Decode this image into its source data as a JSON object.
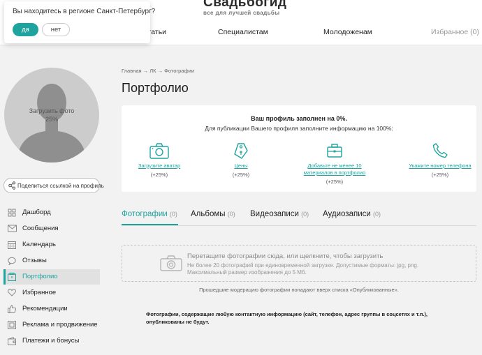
{
  "header": {
    "logo_title": "Свадьбогид",
    "logo_subtitle": "все для лучшей свадьбы",
    "nav": [
      "Статьи",
      "Специалистам",
      "Молодоженам",
      "Избранное (0)"
    ]
  },
  "region_popup": {
    "question": "Вы находитесь в регионе Санкт-Петербург?",
    "yes": "да",
    "no": "нет"
  },
  "profile": {
    "upload_photo": "Загрузить фото",
    "upload_percent": "25%",
    "share_label": "Поделиться ссылкой на профиль"
  },
  "sidebar": {
    "items": [
      {
        "label": "Дашборд",
        "icon": "dashboard-icon"
      },
      {
        "label": "Сообщения",
        "icon": "envelope-icon"
      },
      {
        "label": "Календарь",
        "icon": "calendar-icon"
      },
      {
        "label": "Отзывы",
        "icon": "chat-bubble-icon"
      },
      {
        "label": "Портфолио",
        "icon": "portfolio-icon",
        "active": true
      },
      {
        "label": "Избранное",
        "icon": "heart-icon"
      },
      {
        "label": "Рекомендации",
        "icon": "thumbs-up-icon"
      },
      {
        "label": "Реклама и продвижение",
        "icon": "ad-icon"
      },
      {
        "label": "Платежи и бонусы",
        "icon": "wallet-icon"
      }
    ]
  },
  "main": {
    "breadcrumb": "Главная → ЛК → Фотографии",
    "title": "Портфолио",
    "completion": {
      "headline": "Ваш профиль заполнен на 0%.",
      "subline": "Для публикации Вашего профиля заполните информацию на 100%:",
      "items": [
        {
          "label": "Загрузите аватар",
          "percent": "(+25%)",
          "icon": "camera-icon"
        },
        {
          "label": "Цены",
          "percent": "(+25%)",
          "icon": "price-tag-icon"
        },
        {
          "label": "Добавьте не менее 10 материалов в портфолио",
          "percent": "(+25%)",
          "icon": "briefcase-icon"
        },
        {
          "label": "Укажите номер телефона",
          "percent": "(+25%)",
          "icon": "phone-icon"
        }
      ]
    },
    "tabs": [
      {
        "label": "Фотографии",
        "count": "(0)",
        "active": true
      },
      {
        "label": "Альбомы",
        "count": "(0)"
      },
      {
        "label": "Видеозаписи",
        "count": "(0)"
      },
      {
        "label": "Аудиозаписи",
        "count": "(0)"
      }
    ],
    "dropzone": {
      "main": "Перетащите фотографии сюда, или щелкните, чтобы загрузить",
      "line1": "Не более 20 фотографий при единовременной загрузке. Допустимые форматы: jpg, png.",
      "line2": "Максимальный размер изображения до 5 Мб."
    },
    "moderation_note": "Прошедшие модерацию фотографии попадают вверх списка «Опубликованные».",
    "contact_note": "Фотографии, содержащие любую контактную информацию (сайт, телефон, адрес группы в соцсетях и т.п.), опубликованы не будут."
  },
  "colors": {
    "accent": "#1fa39e",
    "background": "#f2f2f2"
  }
}
